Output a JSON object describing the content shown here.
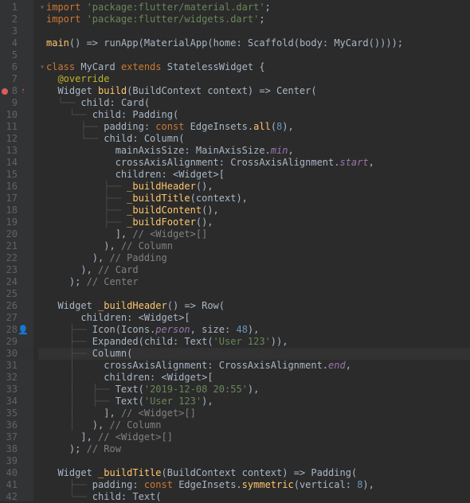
{
  "lines": [
    {
      "n": 1,
      "mark": "",
      "fold": "▾",
      "code": [
        [
          "kw",
          "import "
        ],
        [
          "str",
          "'package:flutter/material.dart'"
        ],
        [
          "punct",
          ";"
        ]
      ]
    },
    {
      "n": 2,
      "mark": "",
      "fold": "",
      "code": [
        [
          "kw",
          "import "
        ],
        [
          "str",
          "'package:flutter/widgets.dart'"
        ],
        [
          "punct",
          ";"
        ]
      ]
    },
    {
      "n": 3,
      "mark": "",
      "fold": "",
      "code": [
        [
          "",
          ""
        ]
      ]
    },
    {
      "n": 4,
      "mark": "",
      "fold": "",
      "code": [
        [
          "fn",
          "main"
        ],
        [
          "punct",
          "() => "
        ],
        [
          "type",
          "runApp("
        ],
        [
          "type",
          "MaterialApp"
        ],
        [
          "punct",
          "("
        ],
        [
          "param",
          "home: "
        ],
        [
          "type",
          "Scaffold"
        ],
        [
          "punct",
          "("
        ],
        [
          "param",
          "body: "
        ],
        [
          "type",
          "MyCard"
        ],
        [
          "punct",
          "())));"
        ]
      ]
    },
    {
      "n": 5,
      "mark": "",
      "fold": "",
      "code": [
        [
          "",
          ""
        ]
      ]
    },
    {
      "n": 6,
      "mark": "",
      "fold": "▾",
      "code": [
        [
          "kw",
          "class "
        ],
        [
          "type",
          "MyCard "
        ],
        [
          "kw",
          "extends "
        ],
        [
          "type",
          "StatelessWidget {"
        ]
      ]
    },
    {
      "n": 7,
      "mark": "",
      "fold": "",
      "code": [
        [
          "",
          "  "
        ],
        [
          "ann",
          "@override"
        ]
      ]
    },
    {
      "n": 8,
      "mark": "bp",
      "fold": "",
      "code": [
        [
          "",
          "  "
        ],
        [
          "type",
          "Widget "
        ],
        [
          "fn",
          "build"
        ],
        [
          "punct",
          "("
        ],
        [
          "type",
          "BuildContext "
        ],
        [
          "param",
          "context"
        ],
        [
          "punct",
          ") => "
        ],
        [
          "type",
          "Center"
        ],
        [
          "punct",
          "("
        ]
      ]
    },
    {
      "n": 9,
      "mark": "",
      "fold": "",
      "code": [
        [
          "guide",
          "  └── "
        ],
        [
          "param",
          "child: "
        ],
        [
          "type",
          "Card"
        ],
        [
          "punct",
          "("
        ]
      ]
    },
    {
      "n": 10,
      "mark": "",
      "fold": "",
      "code": [
        [
          "guide",
          "    └── "
        ],
        [
          "param",
          "child: "
        ],
        [
          "type",
          "Padding"
        ],
        [
          "punct",
          "("
        ]
      ]
    },
    {
      "n": 11,
      "mark": "",
      "fold": "",
      "code": [
        [
          "guide",
          "      ├── "
        ],
        [
          "param",
          "padding: "
        ],
        [
          "kw",
          "const "
        ],
        [
          "type",
          "EdgeInsets."
        ],
        [
          "fn",
          "all"
        ],
        [
          "punct",
          "("
        ],
        [
          "num",
          "8"
        ],
        [
          "punct",
          "),"
        ]
      ]
    },
    {
      "n": 12,
      "mark": "",
      "fold": "",
      "code": [
        [
          "guide",
          "      └── "
        ],
        [
          "param",
          "child: "
        ],
        [
          "type",
          "Column"
        ],
        [
          "punct",
          "("
        ]
      ]
    },
    {
      "n": 13,
      "mark": "",
      "fold": "",
      "code": [
        [
          "guide",
          "            "
        ],
        [
          "param",
          "mainAxisSize: "
        ],
        [
          "type",
          "MainAxisSize."
        ],
        [
          "enum",
          "min"
        ],
        [
          "punct",
          ","
        ]
      ]
    },
    {
      "n": 14,
      "mark": "",
      "fold": "",
      "code": [
        [
          "guide",
          "            "
        ],
        [
          "param",
          "crossAxisAlignment: "
        ],
        [
          "type",
          "CrossAxisAlignment."
        ],
        [
          "enum",
          "start"
        ],
        [
          "punct",
          ","
        ]
      ]
    },
    {
      "n": 15,
      "mark": "",
      "fold": "",
      "code": [
        [
          "guide",
          "            "
        ],
        [
          "param",
          "children: "
        ],
        [
          "punct",
          "<"
        ],
        [
          "type",
          "Widget"
        ],
        [
          "punct",
          ">["
        ]
      ]
    },
    {
      "n": 16,
      "mark": "",
      "fold": "",
      "code": [
        [
          "guide",
          "          ├── "
        ],
        [
          "fn",
          "_buildHeader"
        ],
        [
          "punct",
          "(),"
        ]
      ]
    },
    {
      "n": 17,
      "mark": "",
      "fold": "",
      "code": [
        [
          "guide",
          "          ├── "
        ],
        [
          "fn",
          "_buildTitle"
        ],
        [
          "punct",
          "("
        ],
        [
          "param",
          "context"
        ],
        [
          "punct",
          "),"
        ]
      ]
    },
    {
      "n": 18,
      "mark": "",
      "fold": "",
      "code": [
        [
          "guide",
          "          ├── "
        ],
        [
          "fn",
          "_buildContent"
        ],
        [
          "punct",
          "(),"
        ]
      ]
    },
    {
      "n": 19,
      "mark": "",
      "fold": "",
      "code": [
        [
          "guide",
          "          ├── "
        ],
        [
          "fn",
          "_buildFooter"
        ],
        [
          "punct",
          "(),"
        ]
      ]
    },
    {
      "n": 20,
      "mark": "",
      "fold": "",
      "code": [
        [
          "guide",
          "            "
        ],
        [
          "punct",
          "], "
        ],
        [
          "comment",
          "// <Widget>[]"
        ]
      ]
    },
    {
      "n": 21,
      "mark": "",
      "fold": "",
      "code": [
        [
          "guide",
          "          "
        ],
        [
          "punct",
          "), "
        ],
        [
          "comment",
          "// Column"
        ]
      ]
    },
    {
      "n": 22,
      "mark": "",
      "fold": "",
      "code": [
        [
          "guide",
          "        "
        ],
        [
          "punct",
          "), "
        ],
        [
          "comment",
          "// Padding"
        ]
      ]
    },
    {
      "n": 23,
      "mark": "",
      "fold": "",
      "code": [
        [
          "guide",
          "      "
        ],
        [
          "punct",
          "), "
        ],
        [
          "comment",
          "// Card"
        ]
      ]
    },
    {
      "n": 24,
      "mark": "",
      "fold": "",
      "code": [
        [
          "guide",
          "    "
        ],
        [
          "punct",
          "); "
        ],
        [
          "comment",
          "// Center"
        ]
      ]
    },
    {
      "n": 25,
      "mark": "",
      "fold": "",
      "code": [
        [
          "",
          ""
        ]
      ]
    },
    {
      "n": 26,
      "mark": "",
      "fold": "",
      "code": [
        [
          "",
          "  "
        ],
        [
          "type",
          "Widget "
        ],
        [
          "fn",
          "_buildHeader"
        ],
        [
          "punct",
          "() => "
        ],
        [
          "type",
          "Row"
        ],
        [
          "punct",
          "("
        ]
      ]
    },
    {
      "n": 27,
      "mark": "",
      "fold": "",
      "code": [
        [
          "guide",
          "      "
        ],
        [
          "param",
          "children: "
        ],
        [
          "punct",
          "<"
        ],
        [
          "type",
          "Widget"
        ],
        [
          "punct",
          ">["
        ]
      ]
    },
    {
      "n": 28,
      "mark": "user",
      "fold": "",
      "code": [
        [
          "guide",
          "    ├── "
        ],
        [
          "type",
          "Icon"
        ],
        [
          "punct",
          "("
        ],
        [
          "type",
          "Icons."
        ],
        [
          "enum",
          "person"
        ],
        [
          "punct",
          ", "
        ],
        [
          "param",
          "size: "
        ],
        [
          "num",
          "48"
        ],
        [
          "punct",
          "),"
        ]
      ]
    },
    {
      "n": 29,
      "mark": "",
      "fold": "",
      "code": [
        [
          "guide",
          "    ├── "
        ],
        [
          "type",
          "Expanded"
        ],
        [
          "punct",
          "("
        ],
        [
          "param",
          "child: "
        ],
        [
          "type",
          "Text"
        ],
        [
          "punct",
          "("
        ],
        [
          "str",
          "'User 123'"
        ],
        [
          "punct",
          ")),"
        ]
      ]
    },
    {
      "n": 30,
      "mark": "",
      "fold": "",
      "hl": true,
      "code": [
        [
          "guide",
          "    ├── "
        ],
        [
          "type",
          "Column"
        ],
        [
          "punct",
          "("
        ]
      ]
    },
    {
      "n": 31,
      "mark": "",
      "fold": "",
      "code": [
        [
          "guide",
          "    │     "
        ],
        [
          "param",
          "crossAxisAlignment: "
        ],
        [
          "type",
          "CrossAxisAlignment."
        ],
        [
          "enum",
          "end"
        ],
        [
          "punct",
          ","
        ]
      ]
    },
    {
      "n": 32,
      "mark": "",
      "fold": "",
      "code": [
        [
          "guide",
          "    │     "
        ],
        [
          "param",
          "children: "
        ],
        [
          "punct",
          "<"
        ],
        [
          "type",
          "Widget"
        ],
        [
          "punct",
          ">["
        ]
      ]
    },
    {
      "n": 33,
      "mark": "",
      "fold": "",
      "code": [
        [
          "guide",
          "    │   ├── "
        ],
        [
          "type",
          "Text"
        ],
        [
          "punct",
          "("
        ],
        [
          "str",
          "'2019-12-08 20:55'"
        ],
        [
          "punct",
          "),"
        ]
      ]
    },
    {
      "n": 34,
      "mark": "",
      "fold": "",
      "code": [
        [
          "guide",
          "    │   ├── "
        ],
        [
          "type",
          "Text"
        ],
        [
          "punct",
          "("
        ],
        [
          "str",
          "'User 123'"
        ],
        [
          "punct",
          "),"
        ]
      ]
    },
    {
      "n": 35,
      "mark": "",
      "fold": "",
      "code": [
        [
          "guide",
          "    │     "
        ],
        [
          "punct",
          "], "
        ],
        [
          "comment",
          "// <Widget>[]"
        ]
      ]
    },
    {
      "n": 36,
      "mark": "",
      "fold": "",
      "code": [
        [
          "guide",
          "    │   "
        ],
        [
          "punct",
          "), "
        ],
        [
          "comment",
          "// Column"
        ]
      ]
    },
    {
      "n": 37,
      "mark": "",
      "fold": "",
      "code": [
        [
          "guide",
          "      "
        ],
        [
          "punct",
          "], "
        ],
        [
          "comment",
          "// <Widget>[]"
        ]
      ]
    },
    {
      "n": 38,
      "mark": "",
      "fold": "",
      "code": [
        [
          "guide",
          "    "
        ],
        [
          "punct",
          "); "
        ],
        [
          "comment",
          "// Row"
        ]
      ]
    },
    {
      "n": 39,
      "mark": "",
      "fold": "",
      "code": [
        [
          "",
          ""
        ]
      ]
    },
    {
      "n": 40,
      "mark": "",
      "fold": "",
      "code": [
        [
          "",
          "  "
        ],
        [
          "type",
          "Widget "
        ],
        [
          "fn",
          "_buildTitle"
        ],
        [
          "punct",
          "("
        ],
        [
          "type",
          "BuildContext "
        ],
        [
          "param",
          "context"
        ],
        [
          "punct",
          ") => "
        ],
        [
          "type",
          "Padding"
        ],
        [
          "punct",
          "("
        ]
      ]
    },
    {
      "n": 41,
      "mark": "",
      "fold": "",
      "code": [
        [
          "guide",
          "    ├── "
        ],
        [
          "param",
          "padding: "
        ],
        [
          "kw",
          "const "
        ],
        [
          "type",
          "EdgeInsets."
        ],
        [
          "fn",
          "symmetric"
        ],
        [
          "punct",
          "("
        ],
        [
          "param",
          "vertical: "
        ],
        [
          "num",
          "8"
        ],
        [
          "punct",
          "),"
        ]
      ]
    },
    {
      "n": 42,
      "mark": "",
      "fold": "",
      "code": [
        [
          "guide",
          "    └── "
        ],
        [
          "param",
          "child: "
        ],
        [
          "type",
          "Text"
        ],
        [
          "punct",
          "("
        ]
      ]
    }
  ]
}
